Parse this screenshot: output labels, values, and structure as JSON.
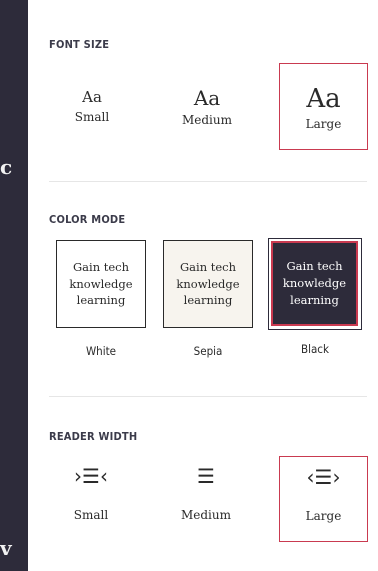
{
  "background": {
    "text_fragment_1": "c",
    "text_fragment_2": "v"
  },
  "font_size": {
    "title": "FONT SIZE",
    "options": [
      {
        "sample": "Aa",
        "label": "Small"
      },
      {
        "sample": "Aa",
        "label": "Medium"
      },
      {
        "sample": "Aa",
        "label": "Large"
      }
    ],
    "selected": "Large"
  },
  "color_mode": {
    "title": "COLOR MODE",
    "preview_lines": [
      "Gain tech",
      "knowledge",
      "learning"
    ],
    "options": [
      {
        "label": "White"
      },
      {
        "label": "Sepia"
      },
      {
        "label": "Black"
      }
    ],
    "selected": "Black"
  },
  "reader_width": {
    "title": "READER WIDTH",
    "options": [
      {
        "icon": "narrow-width-icon",
        "glyph": "›☰‹",
        "label": "Small"
      },
      {
        "icon": "medium-width-icon",
        "glyph": "☰",
        "label": "Medium"
      },
      {
        "icon": "wide-width-icon",
        "glyph": "‹☰›",
        "label": "Large"
      }
    ],
    "selected": "Large"
  },
  "colors": {
    "accent": "#c93a50",
    "dark": "#2d2b3a",
    "sepia": "#f7f4ee"
  }
}
